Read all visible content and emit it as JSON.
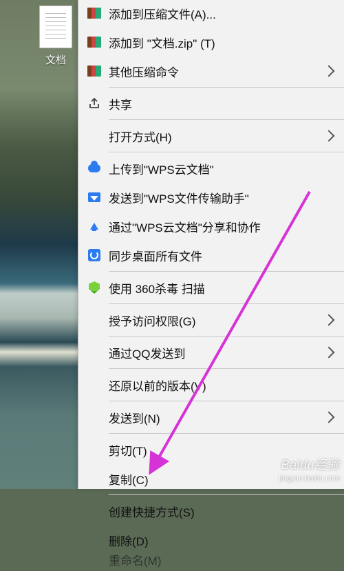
{
  "desktop": {
    "file_label": "文档"
  },
  "menu": {
    "add_to_archive": "添加到压缩文件(A)...",
    "add_to_zip": "添加到 \"文档.zip\" (T)",
    "other_compress": "其他压缩命令",
    "share": "共享",
    "open_with": "打开方式(H)",
    "upload_wps_cloud": "上传到\"WPS云文档\"",
    "send_wps_transfer": "发送到\"WPS文件传输助手\"",
    "share_via_wps": "通过\"WPS云文档\"分享和协作",
    "sync_desktop": "同步桌面所有文件",
    "scan_360": "使用 360杀毒 扫描",
    "grant_access": "授予访问权限(G)",
    "send_via_qq": "通过QQ发送到",
    "restore_previous": "还原以前的版本(V)",
    "send_to": "发送到(N)",
    "cut": "剪切(T)",
    "copy": "复制(C)",
    "create_shortcut": "创建快捷方式(S)",
    "delete": "删除(D)",
    "rename": "重命名(M)"
  },
  "watermark": {
    "brand": "Baidu经验",
    "url": "jingyan.baidu.com"
  }
}
